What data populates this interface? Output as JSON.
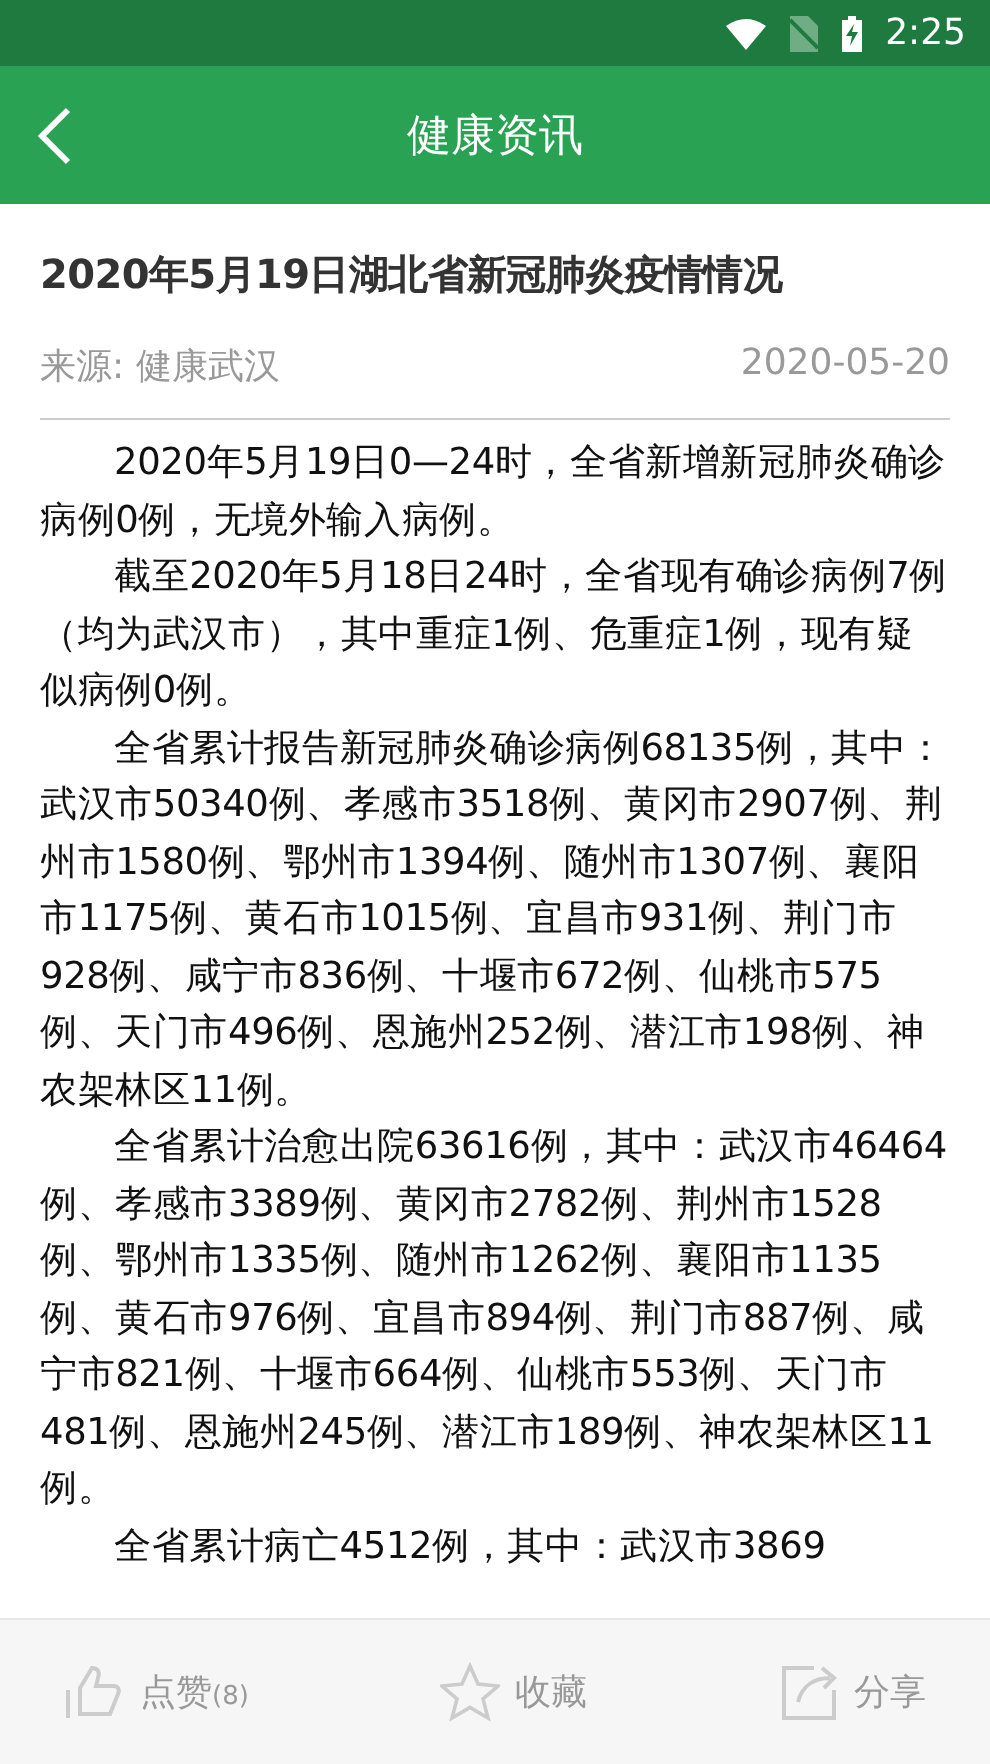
{
  "status_bar": {
    "time": "2:25"
  },
  "header": {
    "title": "健康资讯"
  },
  "article": {
    "title": "2020年5月19日湖北省新冠肺炎疫情情况",
    "source": "来源: 健康武汉",
    "date": "2020-05-20",
    "paragraphs": [
      "2020年5月19日0—24时，全省新增新冠肺炎确诊病例0例，无境外输入病例。",
      "截至2020年5月18日24时，全省现有确诊病例7例（均为武汉市），其中重症1例、危重症1例，现有疑似病例0例。",
      "全省累计报告新冠肺炎确诊病例68135例，其中：武汉市50340例、孝感市3518例、黄冈市2907例、荆州市1580例、鄂州市1394例、随州市1307例、襄阳市1175例、黄石市1015例、宜昌市931例、荆门市928例、咸宁市836例、十堰市672例、仙桃市575例、天门市496例、恩施州252例、潜江市198例、神农架林区11例。",
      "全省累计治愈出院63616例，其中：武汉市46464例、孝感市3389例、黄冈市2782例、荆州市1528例、鄂州市1335例、随州市1262例、襄阳市1135例、黄石市976例、宜昌市894例、荆门市887例、咸宁市821例、十堰市664例、仙桃市553例、天门市481例、恩施州245例、潜江市189例、神农架林区11例。",
      "全省累计病亡4512例，其中：武汉市3869"
    ]
  },
  "actions": [
    {
      "kind": "like",
      "label": "点赞",
      "count": "(8)"
    },
    {
      "kind": "favorite",
      "label": "收藏"
    },
    {
      "kind": "share",
      "label": "分享"
    }
  ]
}
